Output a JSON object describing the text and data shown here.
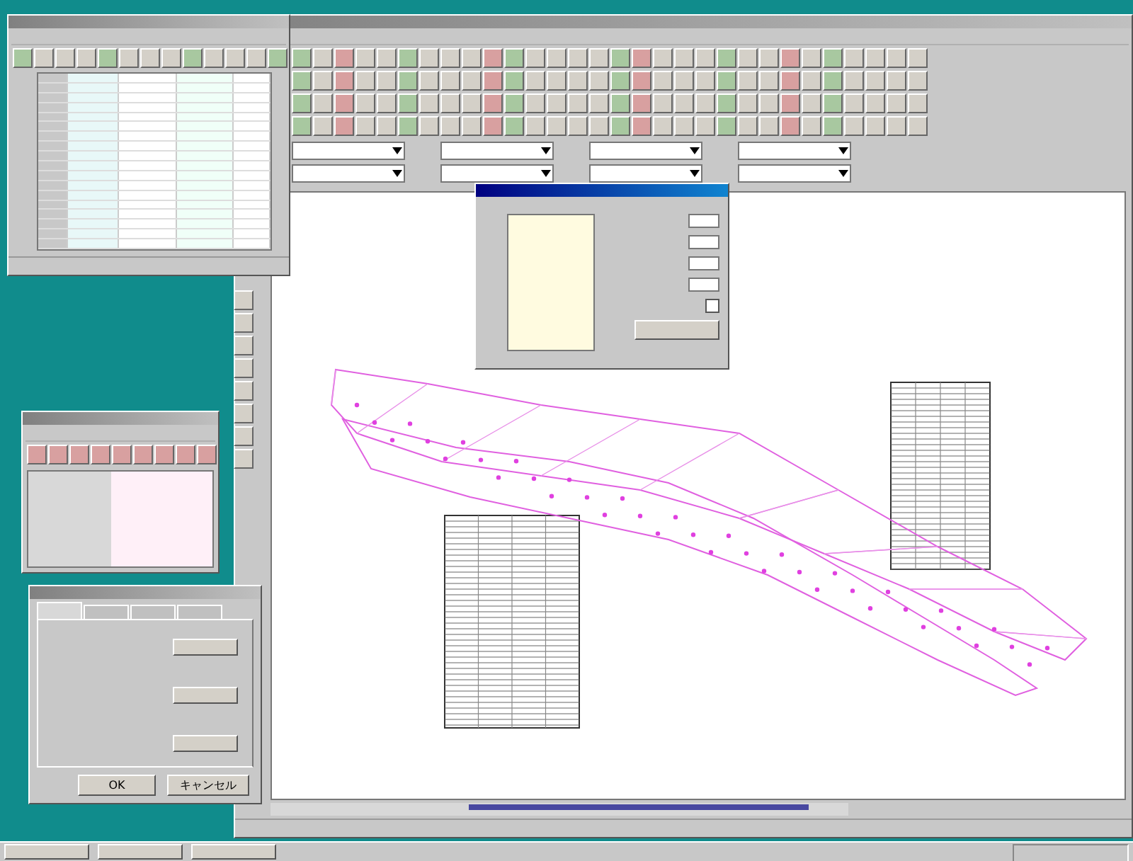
{
  "settings_dialog": {
    "tabs": [
      {
        "selected": true
      },
      {
        "selected": false
      },
      {
        "selected": false
      },
      {
        "selected": false
      }
    ],
    "buttons": [
      "OK",
      "キャンセル"
    ]
  },
  "page_dialog": {
    "checkbox": {
      "checked": false
    }
  }
}
